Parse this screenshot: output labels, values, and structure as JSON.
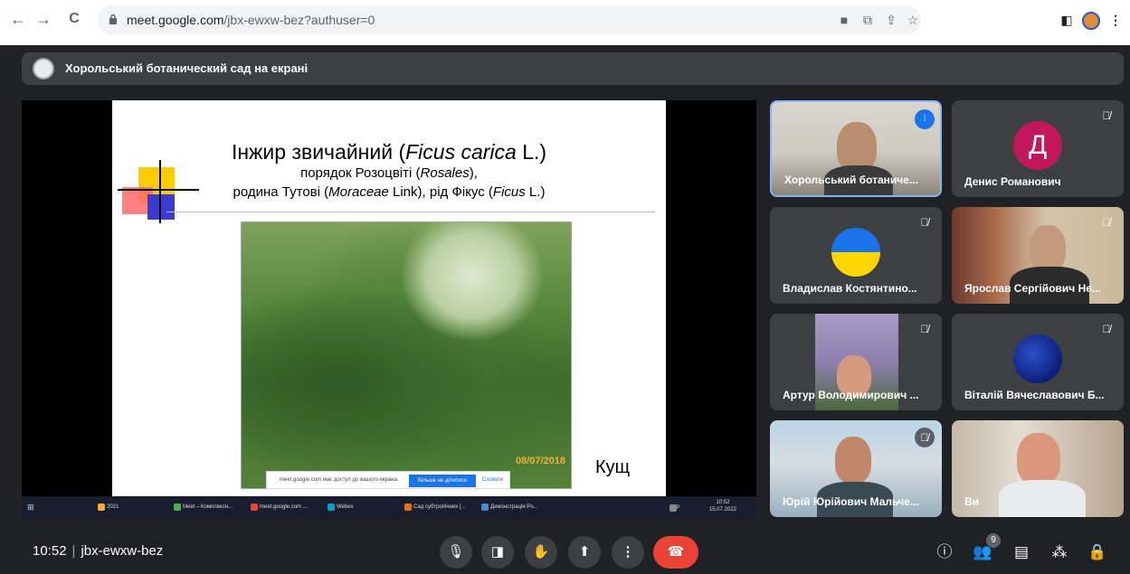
{
  "browser": {
    "url_domain": "meet.google.com",
    "url_path": "/jbx-ewxw-bez?authuser=0",
    "nav": {
      "back": "←",
      "forward": "→",
      "reload": "C"
    }
  },
  "banner": {
    "title": "Хорольський ботанический сад на екрані"
  },
  "slide": {
    "title_prefix": "Інжир звичайний (",
    "title_italic": "Ficus carica",
    "title_suffix": " L.)",
    "line2_prefix": "порядок Розоцвіті (",
    "line2_italic": "Rosales",
    "line2_suffix": "),",
    "line3_a": "родина Тутові (",
    "line3_b": "Moraceae",
    "line3_c": " Link), рід Фікус (",
    "line3_d": "Ficus",
    "line3_e": " L.)",
    "photo_date": "08/07/2018",
    "caption": "Кущ",
    "share_text": "meet.google.com має доступ до вашого екрана.",
    "share_stop": "Більше не ділитися",
    "share_hide": "Сховати"
  },
  "taskbar": {
    "items": [
      "2021",
      "Meet – Комплексн...",
      "meet.google.com ...",
      "Webex",
      "Сад субтропічних [...",
      "Демонстрація Po..."
    ],
    "lang": "УКР",
    "time": "10:52",
    "date": "15.07.2022"
  },
  "participants": [
    {
      "name": "Хорольський ботаниче...",
      "speaking": true
    },
    {
      "name": "Денис Романович",
      "initial": "Д",
      "muted": true
    },
    {
      "name": "Владислав Костянтино...",
      "muted": true
    },
    {
      "name": "Ярослав Сергійович Не...",
      "muted": true
    },
    {
      "name": "Артур Володимирович ...",
      "muted": true
    },
    {
      "name": "Віталій Вячеславович Б...",
      "muted": true
    },
    {
      "name": "Юрій Юрійович Мальче...",
      "muted": true
    },
    {
      "name": "Ви"
    }
  ],
  "controls": {
    "time": "10:52",
    "separator": "|",
    "meeting_code": "jbx-ewxw-bez",
    "people_count": "9"
  },
  "colors": {
    "end_call": "#ea4335",
    "accent": "#1a73e8",
    "background": "#202124"
  }
}
